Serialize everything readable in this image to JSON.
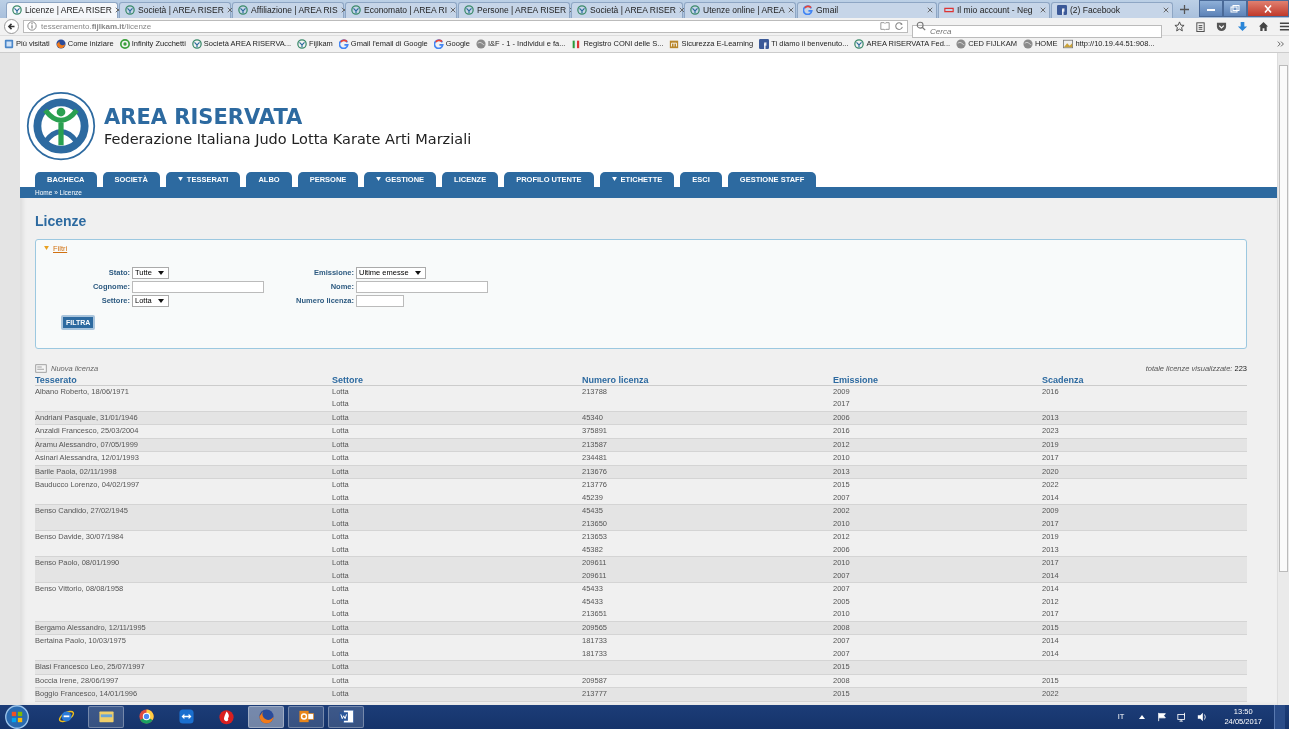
{
  "browser": {
    "tabs": [
      {
        "title": "Licenze | AREA RISER",
        "selected": true
      },
      {
        "title": "Società | AREA RISER",
        "selected": false
      },
      {
        "title": "Affiliazione | AREA RIS",
        "selected": false
      },
      {
        "title": "Economato | AREA RI",
        "selected": false
      },
      {
        "title": "Persone | AREA RISER",
        "selected": false
      },
      {
        "title": "Società | AREA RISER",
        "selected": false
      },
      {
        "title": "Utenze online | AREA",
        "selected": false
      },
      {
        "title": "Gmail",
        "selected": false
      },
      {
        "title": "Il mio account - Neg",
        "selected": false
      },
      {
        "title": "(2) Facebook",
        "selected": false
      }
    ],
    "address": {
      "url": "tesseramento.**fijlkam.it**/licenze"
    },
    "search": {
      "placeholder": "Cerca"
    },
    "bookmarks": [
      "Più visitati",
      "Come iniziare",
      "Infinity Zucchetti",
      "Società AREA RISERVA...",
      "Fijlkam",
      "Gmail l'email di Google",
      "Google",
      "I&F - 1 - Individui e fa...",
      "Registro CONI delle S...",
      "Sicurezza E-Learning",
      "Ti diamo il benvenuto...",
      "AREA RISERVATA Fed...",
      "CED FIJLKAM",
      "HOME",
      "http://10.19.44.51:908..."
    ]
  },
  "page": {
    "title": "AREA RISERVATA",
    "subtitle": "Federazione Italiana Judo Lotta Karate Arti Marziali",
    "nav": [
      {
        "label": "BACHECA",
        "menu": false
      },
      {
        "label": "SOCIETÀ",
        "menu": false
      },
      {
        "label": "TESSERATI",
        "menu": true
      },
      {
        "label": "ALBO",
        "menu": false
      },
      {
        "label": "PERSONE",
        "menu": false
      },
      {
        "label": "GESTIONE",
        "menu": true
      },
      {
        "label": "LICENZE",
        "menu": false
      },
      {
        "label": "PROFILO UTENTE",
        "menu": false
      },
      {
        "label": "ETICHETTE",
        "menu": true
      },
      {
        "label": "ESCI",
        "menu": false
      },
      {
        "label": "GESTIONE STAFF",
        "menu": false
      }
    ],
    "breadcrumb": "Home » Licenze",
    "heading": "Licenze",
    "filters": {
      "toggle": "Filtri",
      "expanded": true,
      "rows": [
        [
          {
            "label": "Stato:",
            "kind": "select",
            "value": "Tutte"
          },
          {
            "label": "Emissione:",
            "kind": "select",
            "value": "Ultime emesse"
          }
        ],
        [
          {
            "label": "Cognome:",
            "kind": "text"
          },
          {
            "label": "Nome:",
            "kind": "text"
          }
        ],
        [
          {
            "label": "Settore:",
            "kind": "select",
            "value": "Lotta"
          },
          {
            "label": "Numero licenza:",
            "kind": "short"
          }
        ]
      ],
      "button": "FILTRA"
    },
    "new_link": "Nuova licenza",
    "total_label": "totale licenze visualizzate:",
    "total_value": "223",
    "table": {
      "columns": [
        "Tesserato",
        "Settore",
        "Numero licenza",
        "Emissione",
        "Scadenza"
      ],
      "rows": [
        {
          "tesserato": "Albano Roberto, 18/06/1971",
          "licenses": [
            {
              "settore": "Lotta",
              "numero": "213788",
              "emissione": "2009",
              "scadenza": "2016"
            },
            {
              "settore": "Lotta",
              "emissione": "2017"
            }
          ]
        },
        {
          "tesserato": "Andriani Pasquale, 31/01/1946",
          "licenses": [
            {
              "settore": "Lotta",
              "numero": "45340",
              "emissione": "2006",
              "scadenza": "2013"
            }
          ]
        },
        {
          "tesserato": "Anzaldi Francesco, 25/03/2004",
          "licenses": [
            {
              "settore": "Lotta",
              "numero": "375891",
              "emissione": "2016",
              "scadenza": "2023"
            }
          ]
        },
        {
          "tesserato": "Aramu Alessandro, 07/05/1999",
          "licenses": [
            {
              "settore": "Lotta",
              "numero": "213587",
              "emissione": "2012",
              "scadenza": "2019"
            }
          ]
        },
        {
          "tesserato": "Asinari Alessandra, 12/01/1993",
          "licenses": [
            {
              "settore": "Lotta",
              "numero": "234481",
              "emissione": "2010",
              "scadenza": "2017"
            }
          ]
        },
        {
          "tesserato": "Barile Paola, 02/11/1998",
          "licenses": [
            {
              "settore": "Lotta",
              "numero": "213676",
              "emissione": "2013",
              "scadenza": "2020"
            }
          ]
        },
        {
          "tesserato": "Bauducco Lorenzo, 04/02/1997",
          "licenses": [
            {
              "settore": "Lotta",
              "numero": "213776",
              "emissione": "2015",
              "scadenza": "2022"
            },
            {
              "settore": "Lotta",
              "numero": "45239",
              "emissione": "2007",
              "scadenza": "2014"
            }
          ]
        },
        {
          "tesserato": "Benso Candido, 27/02/1945",
          "licenses": [
            {
              "settore": "Lotta",
              "numero": "45435",
              "emissione": "2002",
              "scadenza": "2009"
            },
            {
              "settore": "Lotta",
              "numero": "213650",
              "emissione": "2010",
              "scadenza": "2017"
            }
          ]
        },
        {
          "tesserato": "Benso Davide, 30/07/1984",
          "licenses": [
            {
              "settore": "Lotta",
              "numero": "213653",
              "emissione": "2012",
              "scadenza": "2019"
            },
            {
              "settore": "Lotta",
              "numero": "45382",
              "emissione": "2006",
              "scadenza": "2013"
            }
          ]
        },
        {
          "tesserato": "Benso Paolo, 08/01/1990",
          "licenses": [
            {
              "settore": "Lotta",
              "numero": "209611",
              "emissione": "2010",
              "scadenza": "2017"
            },
            {
              "settore": "Lotta",
              "numero": "209611",
              "emissione": "2007",
              "scadenza": "2014"
            }
          ]
        },
        {
          "tesserato": "Benso Vittorio, 08/08/1958",
          "licenses": [
            {
              "settore": "Lotta",
              "numero": "45433",
              "emissione": "2007",
              "scadenza": "2014"
            },
            {
              "settore": "Lotta",
              "numero": "45433",
              "emissione": "2005",
              "scadenza": "2012"
            },
            {
              "settore": "Lotta",
              "numero": "213651",
              "emissione": "2010",
              "scadenza": "2017"
            }
          ]
        },
        {
          "tesserato": "Bergamo Alessandro, 12/11/1995",
          "licenses": [
            {
              "settore": "Lotta",
              "numero": "209565",
              "emissione": "2008",
              "scadenza": "2015"
            }
          ]
        },
        {
          "tesserato": "Bertaina Paolo, 10/03/1975",
          "licenses": [
            {
              "settore": "Lotta",
              "numero": "181733",
              "emissione": "2007",
              "scadenza": "2014"
            },
            {
              "settore": "Lotta",
              "numero": "181733",
              "emissione": "2007",
              "scadenza": "2014"
            }
          ]
        },
        {
          "tesserato": "Blasi Francesco Leo, 25/07/1997",
          "licenses": [
            {
              "settore": "Lotta",
              "emissione": "2015"
            }
          ]
        },
        {
          "tesserato": "Boccia Irene, 28/06/1997",
          "licenses": [
            {
              "settore": "Lotta",
              "numero": "209587",
              "emissione": "2008",
              "scadenza": "2015"
            }
          ]
        },
        {
          "tesserato": "Boggio Francesco, 14/01/1996",
          "licenses": [
            {
              "settore": "Lotta",
              "numero": "213777",
              "emissione": "2015",
              "scadenza": "2022"
            }
          ]
        }
      ]
    }
  },
  "taskbar": {
    "apps": [
      {
        "running": false,
        "selected": false
      },
      {
        "running": true,
        "selected": false
      },
      {
        "running": false,
        "selected": false
      },
      {
        "running": false,
        "selected": false
      },
      {
        "running": false,
        "selected": false
      },
      {
        "running": true,
        "selected": true
      },
      {
        "running": true,
        "selected": false
      },
      {
        "running": true,
        "selected": false
      }
    ],
    "language": "IT",
    "time": "13:50",
    "date": "24/05/2017"
  }
}
